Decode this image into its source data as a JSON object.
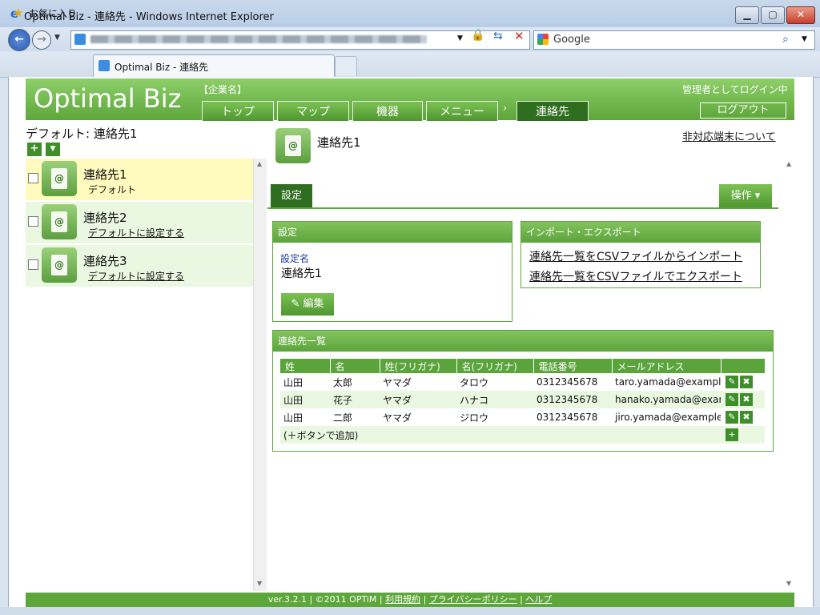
{
  "window": {
    "title": "Optimal Biz - 連絡先 - Windows Internet Explorer"
  },
  "browser": {
    "search_placeholder": "Google",
    "favorites_label": "お気に入り",
    "tab_title": "Optimal Biz - 連絡先"
  },
  "header": {
    "logo": "Optimal Biz",
    "company": "【企業名】",
    "admin_status": "管理者としてログイン中",
    "logout_label": "ログアウト",
    "nav": {
      "top": "トップ",
      "map": "マップ",
      "devices": "機器",
      "menu": "メニュー",
      "arrow": "›",
      "contacts": "連絡先"
    }
  },
  "left": {
    "title": "デフォルト: 連絡先1",
    "items": [
      {
        "name": "連絡先1",
        "sub": "デフォルト"
      },
      {
        "name": "連絡先2",
        "sub": "デフォルトに設定する"
      },
      {
        "name": "連絡先3",
        "sub": "デフォルトに設定する"
      }
    ]
  },
  "main": {
    "title": "連絡先1",
    "unsupported_link": "非対応端末について",
    "settings_tab": "設定",
    "ops_button": "操作 ▾",
    "settings_panel": {
      "header": "設定",
      "name_label": "設定名",
      "name_value": "連絡先1",
      "edit_label": "✎ 編集"
    },
    "import_export_panel": {
      "header": "インポート・エクスポート",
      "import_link": "連絡先一覧をCSVファイルからインポート",
      "export_link": "連絡先一覧をCSVファイルでエクスポート"
    },
    "contact_list": {
      "header": "連絡先一覧",
      "columns": [
        "姓",
        "名",
        "姓(フリガナ)",
        "名(フリガナ)",
        "電話番号",
        "メールアドレス"
      ],
      "rows": [
        [
          "山田",
          "太郎",
          "ヤマダ",
          "タロウ",
          "0312345678",
          "taro.yamada@example.co"
        ],
        [
          "山田",
          "花子",
          "ヤマダ",
          "ハナコ",
          "0312345678",
          "hanako.yamada@example"
        ],
        [
          "山田",
          "二郎",
          "ヤマダ",
          "ジロウ",
          "0312345678",
          "jiro.yamada@example.co"
        ]
      ],
      "add_hint": "(＋ボタンで追加)"
    }
  },
  "footer": {
    "version": "ver.3.2.1 | ©2011 OPTiM |",
    "terms": "利用規約",
    "privacy": "プライバシーポリシー",
    "help": "ヘルプ"
  },
  "icons": {
    "edit": "pencil-icon",
    "delete": "x-icon",
    "add": "plus-icon",
    "address_book": "address-book-icon"
  }
}
